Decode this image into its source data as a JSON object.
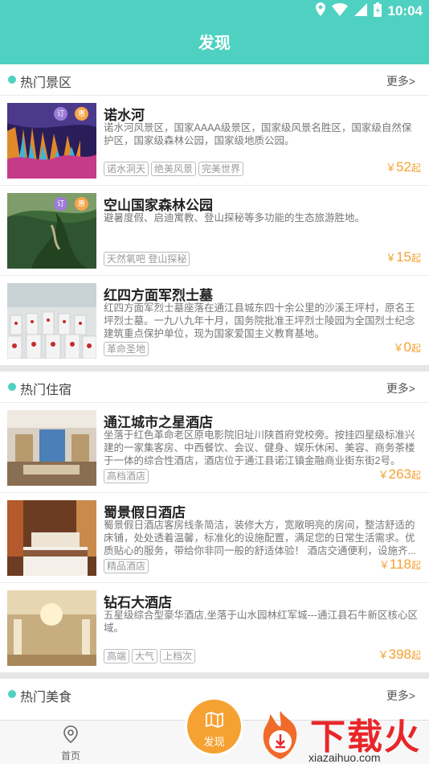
{
  "status": {
    "time": "10:04"
  },
  "header": {
    "title": "发现"
  },
  "sections": [
    {
      "title": "热门景区",
      "more": "更多>",
      "items": [
        {
          "name": "诺水河",
          "desc": "诺水河风景区，国家AAAA级景区，国家级风景名胜区，国家级自然保护区，国家级森林公园，国家级地质公园。",
          "tags": [
            "诺水洞天",
            "绝美风景",
            "完美世界"
          ],
          "price_symbol": "￥",
          "price": "52",
          "price_unit": "起",
          "badges": [
            "订",
            "惠"
          ]
        },
        {
          "name": "空山国家森林公园",
          "desc": "避暑度假、启迪寓教、登山探秘等多功能的生态旅游胜地。",
          "tags": [
            "天然氧吧 登山探秘"
          ],
          "price_symbol": "￥",
          "price": "15",
          "price_unit": "起",
          "badges": [
            "订",
            "惠"
          ]
        },
        {
          "name": "红四方面军烈士墓",
          "desc": "红四方面军烈士墓座落在通江县城东四十余公里的沙溪王坪村，原名王坪烈士墓。一九八九年十月，国务院批准王坪烈士陵园为全国烈士纪念建筑重点保护单位，现为国家爱国主义教育基地。",
          "tags": [
            "革命圣地"
          ],
          "price_symbol": "￥",
          "price": "0",
          "price_unit": "起",
          "badges": []
        }
      ]
    },
    {
      "title": "热门住宿",
      "more": "更多>",
      "items": [
        {
          "name": "通江城市之星酒店",
          "desc": "坐落于红色革命老区原电影院旧址川陕首府党校旁。按挂四星级标准兴建的一家集客房、中西餐饮、会议、健身、娱乐休闲、美容、商务茶楼于一体的综合性酒店，酒店位于通江县诺江镇金融商业街东街2号。",
          "tags": [
            "高档酒店"
          ],
          "price_symbol": "￥",
          "price": "263",
          "price_unit": "起"
        },
        {
          "name": "蜀景假日酒店",
          "desc": "蜀景假日酒店客房线条简洁，装修大方，宽敞明亮的房间，整洁舒适的床铺，处处透着温馨，标准化的设施配置，满足您的日常生活需求。优质贴心的服务，带给你非同一般的舒适体验！ 酒店交通便利，设施齐...",
          "tags": [
            "精品酒店"
          ],
          "price_symbol": "￥",
          "price": "118",
          "price_unit": "起"
        },
        {
          "name": "钻石大酒店",
          "desc": "五星级综合型豪华酒店,坐落于山水园林红军城---通江县石牛新区核心区域。",
          "tags": [
            "高端",
            "大气",
            "上档次"
          ],
          "price_symbol": "￥",
          "price": "398",
          "price_unit": "起"
        }
      ]
    },
    {
      "title": "热门美食",
      "more": "更多>"
    }
  ],
  "bottom_nav": {
    "home_label": "首页",
    "discover_label": "发现"
  },
  "watermark": {
    "text": "下载火",
    "url": "xiazaihuo.com"
  },
  "colors": {
    "accent": "#4fd1c1",
    "price": "#f5a030",
    "fab": "#f5a233"
  }
}
